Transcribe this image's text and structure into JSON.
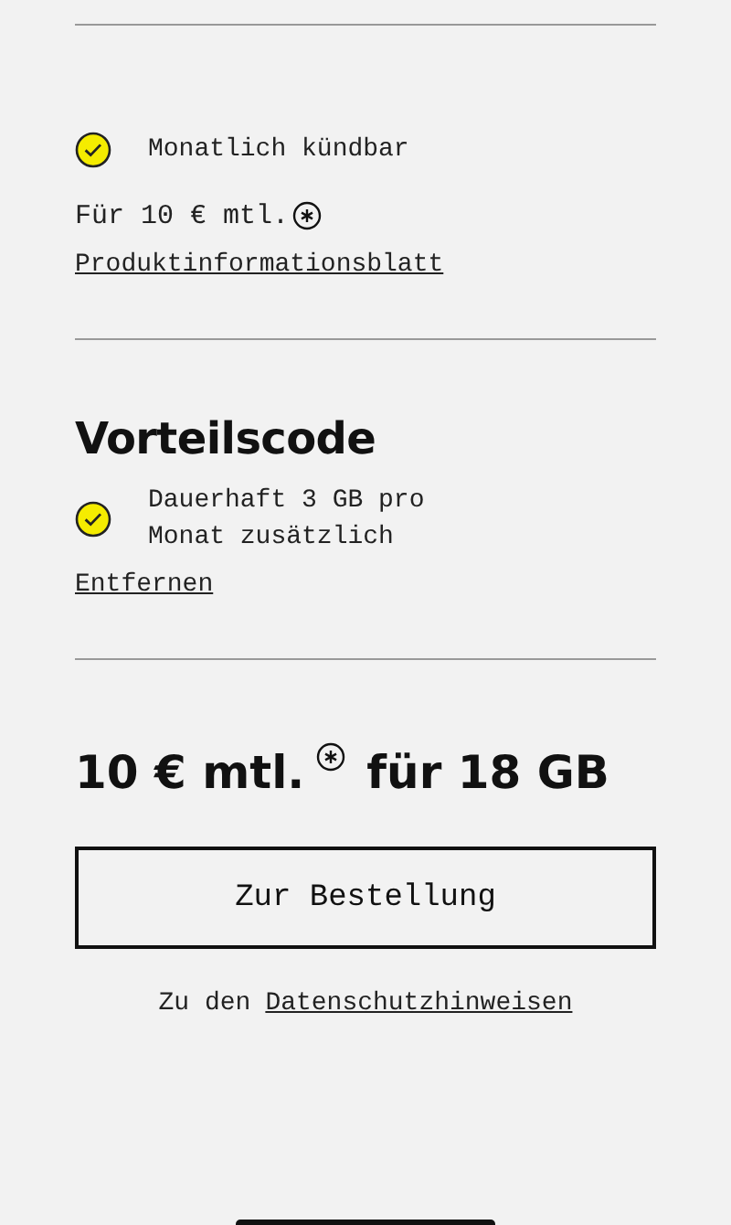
{
  "features": [
    {
      "label": "Monatlich kündbar",
      "checked": true
    }
  ],
  "price_line": {
    "text": "Für 10 € mtl."
  },
  "info_link": "Produktinformationsblatt",
  "promo": {
    "title": "Vorteilscode",
    "items": [
      {
        "label": "Dauerhaft 3 GB pro Monat zusätzlich",
        "checked": true
      }
    ],
    "remove_link": "Entfernen"
  },
  "summary": {
    "price": "10 € mtl.",
    "volume": "für 18 GB"
  },
  "order_button": "Zur Bestellung",
  "privacy": {
    "prefix": "Zu den",
    "link": "Datenschutzhinweisen"
  }
}
